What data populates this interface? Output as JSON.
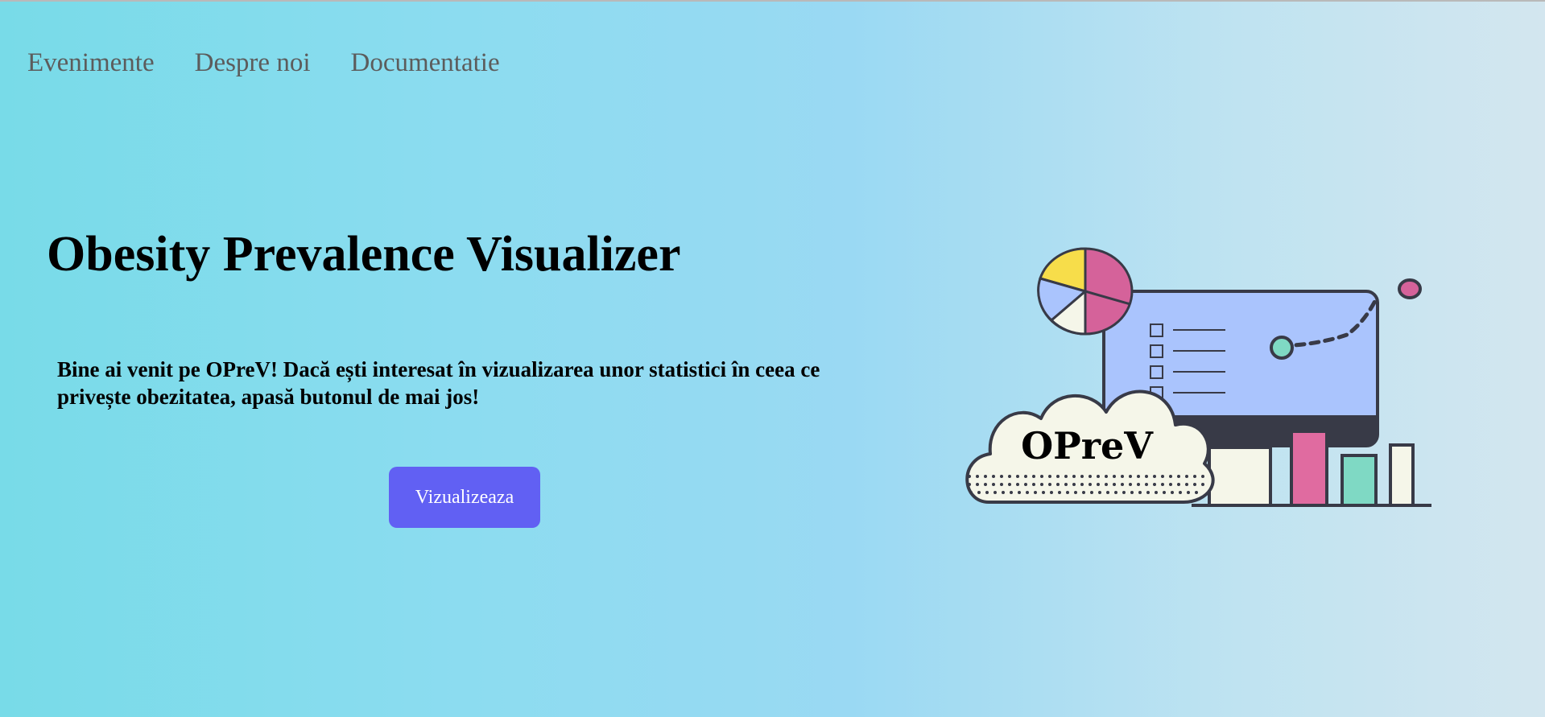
{
  "nav": {
    "items": [
      {
        "label": "Evenimente"
      },
      {
        "label": "Despre noi"
      },
      {
        "label": "Documentatie"
      }
    ]
  },
  "hero": {
    "title": "Obesity Prevalence Visualizer",
    "intro": "Bine ai venit pe OPreV! Dacă ești interesat în vizualizarea unor statistici în ceea ce privește obezitatea, apasă butonul de mai jos!",
    "cta_label": "Vizualizeaza"
  },
  "illustration": {
    "logo_text": "OPreV"
  },
  "colors": {
    "button": "#6160f3",
    "screen": "#aac4fd",
    "pink": "#d5629a",
    "yellow": "#f7dd4a",
    "teal": "#7fd9c4",
    "outline": "#383a47",
    "cream": "#f5f6e9"
  }
}
